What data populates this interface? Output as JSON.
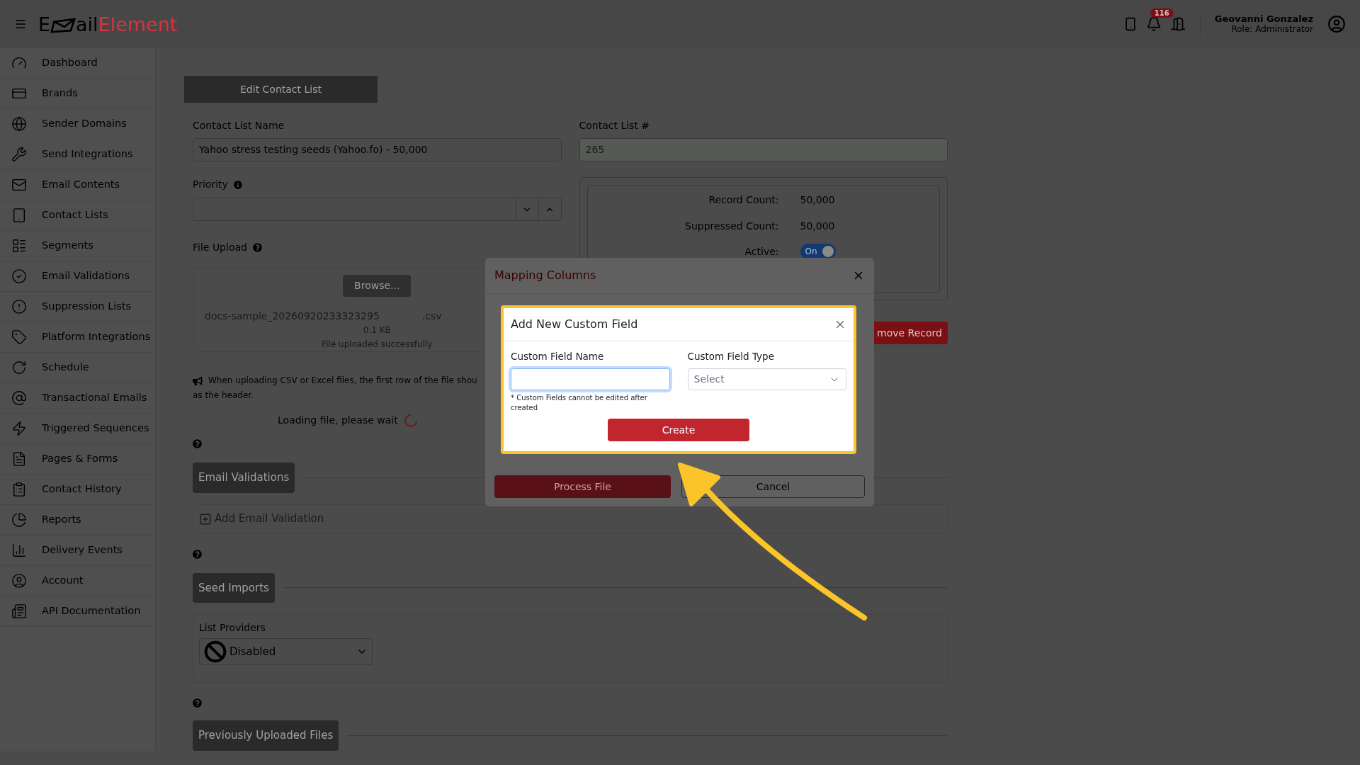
{
  "header": {
    "logo": {
      "lead": "E",
      "mid": "ail",
      "tail": "Element"
    },
    "notifications": {
      "count": "116"
    },
    "user": {
      "name": "Geovanni Gonzalez",
      "role": "Role: Administrator"
    }
  },
  "sidebar": {
    "items": [
      {
        "label": "Dashboard"
      },
      {
        "label": "Brands"
      },
      {
        "label": "Sender Domains"
      },
      {
        "label": "Send Integrations"
      },
      {
        "label": "Email Contents"
      },
      {
        "label": "Contact Lists"
      },
      {
        "label": "Segments"
      },
      {
        "label": "Email Validations"
      },
      {
        "label": "Suppression Lists"
      },
      {
        "label": "Platform Integrations"
      },
      {
        "label": "Schedule"
      },
      {
        "label": "Transactional Emails"
      },
      {
        "label": "Triggered Sequences"
      },
      {
        "label": "Pages & Forms"
      },
      {
        "label": "Contact History"
      },
      {
        "label": "Reports"
      },
      {
        "label": "Delivery Events"
      },
      {
        "label": "Account"
      },
      {
        "label": "API Documentation"
      }
    ]
  },
  "form": {
    "tab": "Edit Contact List",
    "name_field": {
      "label": "Contact List Name",
      "value": "Yahoo stress testing seeds (Yahoo.fo) - 50,000"
    },
    "number_field": {
      "label": "Contact List #",
      "value": "265"
    },
    "priority": {
      "label": "Priority"
    },
    "file_upload": {
      "label": "File Upload",
      "browse": "Browse...",
      "file_name": "docs-sample_20260920233323295",
      "file_ext": ".csv",
      "file_size": "0.1 KB",
      "status": "File uploaded successfully"
    },
    "notice": [
      "When uploading CSV or Excel files, the first row of the file shou",
      "as the header."
    ],
    "loading": "Loading file, please wait",
    "stats": [
      {
        "label": "Record Count:",
        "value": "50,000"
      },
      {
        "label": "Suppressed Count:",
        "value": "50,000"
      }
    ],
    "active": {
      "label": "Active:",
      "on": true,
      "text": "On"
    },
    "remove_button": "move Record",
    "sections": [
      {
        "title": "Email Validations"
      },
      {
        "title": "Seed Imports"
      },
      {
        "title": "Previously Uploaded Files"
      }
    ],
    "add_validation": "Add Email Validation",
    "list_providers": {
      "label": "List Providers",
      "value": "Disabled"
    }
  },
  "mapping_modal": {
    "title": "Mapping Columns",
    "buttons": [
      "Process File",
      "Cancel"
    ]
  },
  "custom_field_dialog": {
    "title": "Add New Custom Field",
    "name_label": "Custom Field Name",
    "type_label": "Custom Field Type",
    "type_placeholder": "Select",
    "note": "* Custom Fields cannot be edited after created",
    "button": "Create"
  }
}
